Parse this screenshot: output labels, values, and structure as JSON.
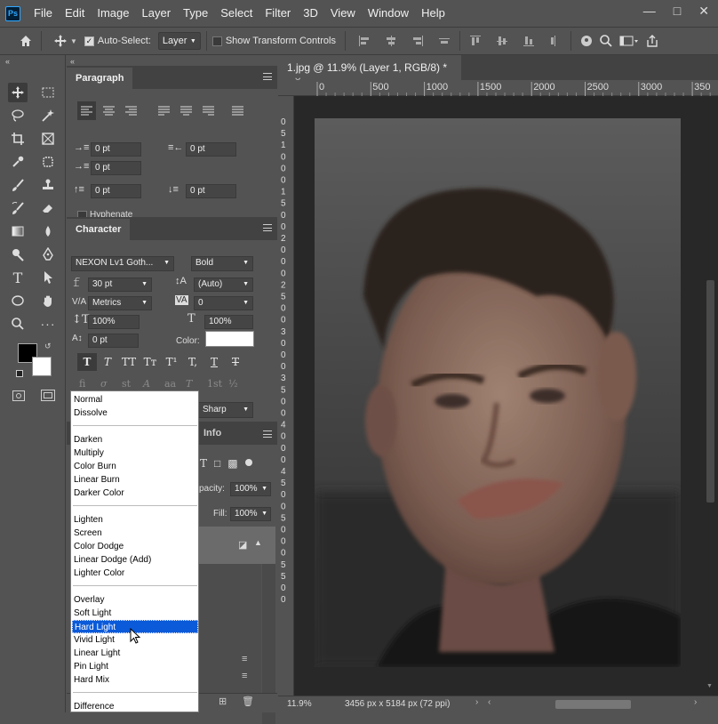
{
  "menubar": {
    "items": [
      "File",
      "Edit",
      "Image",
      "Layer",
      "Type",
      "Select",
      "Filter",
      "3D",
      "View",
      "Window",
      "Help"
    ],
    "logo": "Ps"
  },
  "options": {
    "auto_select_label": "Auto-Select:",
    "auto_select_value": "Layer",
    "transform_label": "Show Transform Controls"
  },
  "paragraph": {
    "title": "Paragraph",
    "indent_left": "0 pt",
    "indent_right": "0 pt",
    "indent_first": "0 pt",
    "space_before": "0 pt",
    "space_after": "0 pt",
    "hyphenate": "Hyphenate"
  },
  "character": {
    "title": "Character",
    "font_family": "NEXON Lv1 Goth...",
    "font_style": "Bold",
    "size": "30 pt",
    "leading": "(Auto)",
    "kerning": "Metrics",
    "tracking": "0",
    "vscale": "100%",
    "hscale": "100%",
    "baseline": "0 pt",
    "color_label": "Color:",
    "antialias": "Sharp",
    "type_styles": [
      "T",
      "T",
      "TT",
      "Tт",
      "T¹",
      "T,",
      "T",
      "T"
    ],
    "opentype": [
      "fi",
      "σ",
      "st",
      "A",
      "aa",
      "T",
      "1st",
      "½"
    ]
  },
  "layers": {
    "info_tab": "Info",
    "opacity_label": "pacity:",
    "opacity": "100%",
    "fill_label": "Fill:",
    "fill": "100%"
  },
  "document": {
    "tab_title": "1.jpg @ 11.9% (Layer 1, RGB/8) *",
    "ruler_top": [
      "0",
      "500",
      "1000",
      "1500",
      "2000",
      "2500",
      "3000",
      "350"
    ],
    "ruler_left": [
      "0",
      "5",
      "1",
      "0",
      "0",
      "0",
      "1",
      "5",
      "0",
      "0",
      "2",
      "0",
      "0",
      "0",
      "2",
      "5",
      "0",
      "0",
      "3",
      "0",
      "0",
      "0",
      "3",
      "5",
      "0",
      "0",
      "4",
      "0",
      "0",
      "0",
      "4",
      "5",
      "0",
      "0",
      "5",
      "0",
      "0",
      "0",
      "5",
      "5",
      "0",
      "0"
    ]
  },
  "status": {
    "zoom": "11.9%",
    "dimensions": "3456 px x 5184 px (72 ppi)"
  },
  "blend_modes": {
    "groups": [
      [
        "Normal",
        "Dissolve"
      ],
      [
        "Darken",
        "Multiply",
        "Color Burn",
        "Linear Burn",
        "Darker Color"
      ],
      [
        "Lighten",
        "Screen",
        "Color Dodge",
        "Linear Dodge (Add)",
        "Lighter Color"
      ],
      [
        "Overlay",
        "Soft Light",
        "Hard Light",
        "Vivid Light",
        "Linear Light",
        "Pin Light",
        "Hard Mix"
      ],
      [
        "Difference"
      ]
    ],
    "selected": "Hard Light"
  },
  "colors": {
    "accent": "#0a5ad9",
    "foreground": "#000000",
    "background": "#ffffff"
  }
}
